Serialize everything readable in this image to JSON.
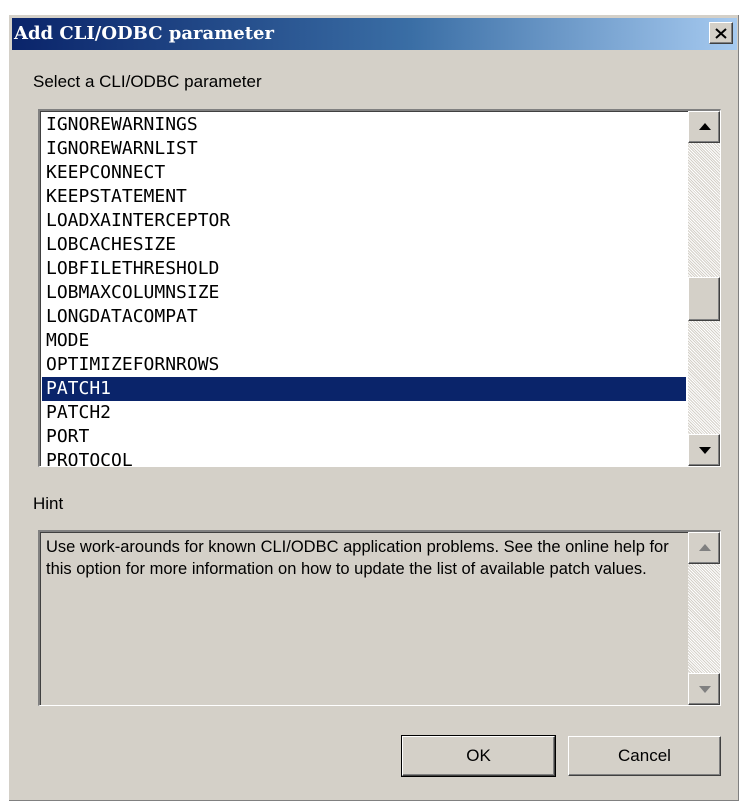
{
  "dialog": {
    "title": "Add CLI/ODBC parameter",
    "close_icon": "close-icon",
    "select_label": "Select a CLI/ODBC parameter",
    "hint_label": "Hint",
    "hint_text": "Use work-arounds for known CLI/ODBC application problems. See the online help for this option for more information on how to update the list of available patch values.",
    "ok_label": "OK",
    "cancel_label": "Cancel"
  },
  "parameters": {
    "items": [
      "IGNOREWARNINGS",
      "IGNOREWARNLIST",
      "KEEPCONNECT",
      "KEEPSTATEMENT",
      "LOADXAINTERCEPTOR",
      "LOBCACHESIZE",
      "LOBFILETHRESHOLD",
      "LOBMAXCOLUMNSIZE",
      "LONGDATACOMPAT",
      "MODE",
      "OPTIMIZEFORNROWS",
      "PATCH1",
      "PATCH2",
      "PORT",
      "PROTOCOL"
    ],
    "selected": "PATCH1"
  },
  "colors": {
    "title_start": "#0a246a",
    "title_end": "#a6caf0",
    "selection": "#0a246a",
    "face": "#d4d0c8"
  }
}
